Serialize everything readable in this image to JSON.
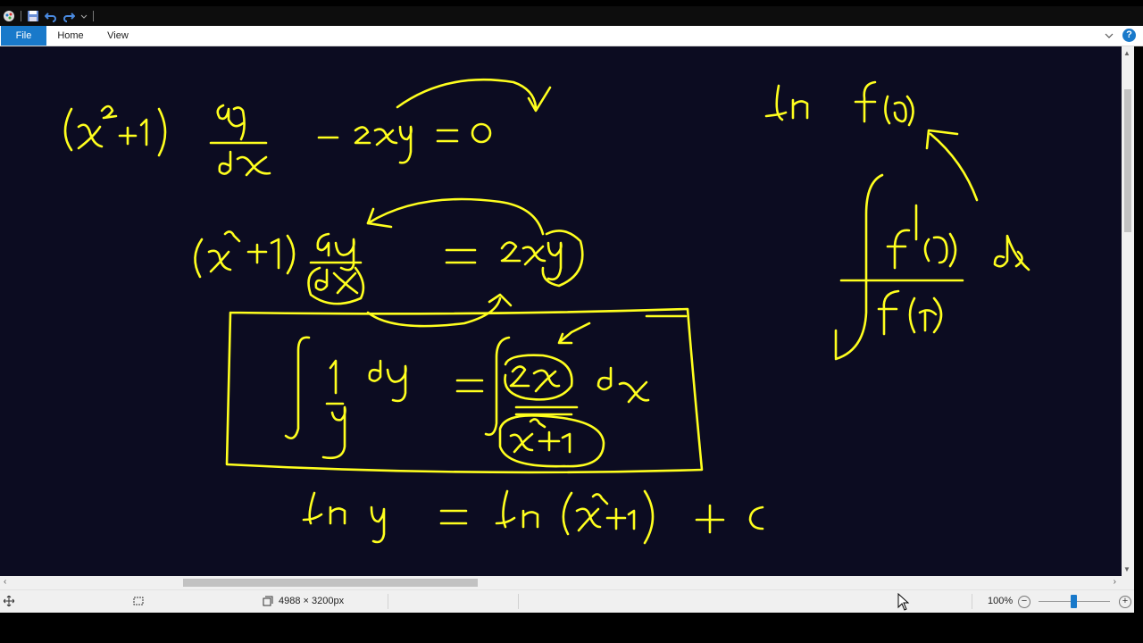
{
  "ribbon": {
    "tabs": [
      {
        "label": "File",
        "active": true
      },
      {
        "label": "Home",
        "active": false
      },
      {
        "label": "View",
        "active": false
      }
    ],
    "help_label": "?"
  },
  "status": {
    "dimensions": "4988 × 3200px",
    "zoom": "100%",
    "zoom_level_percent": 100,
    "zoom_minus": "−",
    "zoom_plus": "+"
  },
  "canvas": {
    "background": "#0c0c21",
    "ink_color": "#ffff1e"
  },
  "colors": {
    "accent": "#1979ca"
  }
}
